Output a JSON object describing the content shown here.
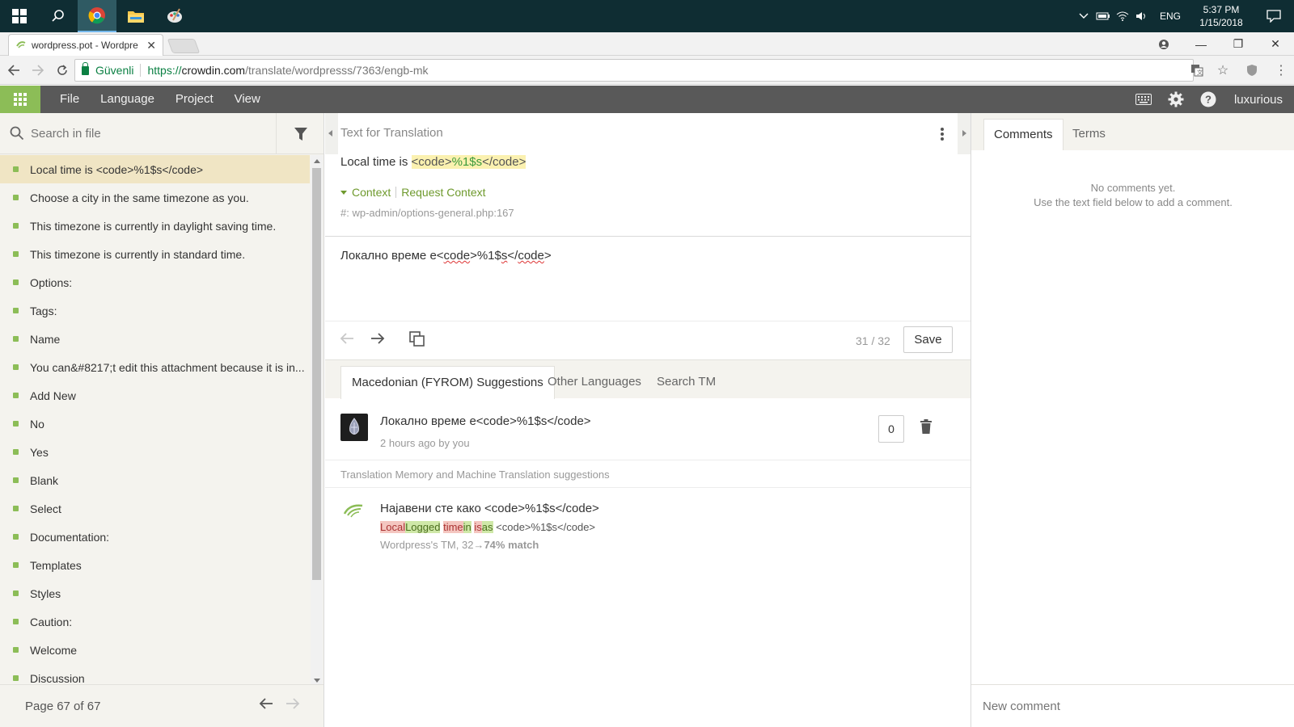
{
  "taskbar": {
    "language": "ENG",
    "time": "5:37 PM",
    "date": "1/15/2018"
  },
  "browser": {
    "tab_title": "wordpress.pot - Wordpre",
    "secure_label": "Güvenli",
    "url_scheme": "https://",
    "url_host": "crowdin.com",
    "url_path": "/translate/wordpresss/7363/engb-mk"
  },
  "header": {
    "menu": [
      "File",
      "Language",
      "Project",
      "View"
    ],
    "username": "luxurious",
    "accent_color": "#8cbd57"
  },
  "left": {
    "search_placeholder": "Search in file",
    "strings": [
      "Local time is <code>%1$s</code>",
      "Choose a city in the same timezone as you.",
      "This timezone is currently in daylight saving time.",
      "This timezone is currently in standard time.",
      "Options:",
      "Tags:",
      "Name",
      "You can&#8217;t edit this attachment because it is in...",
      "Add New",
      "No",
      "Yes",
      "Blank",
      "Select",
      "Documentation:",
      "Templates",
      "Styles",
      "Caution:",
      "Welcome",
      "Discussion"
    ],
    "page_label": "Page 67 of 67"
  },
  "editor": {
    "source_label": "Text for Translation",
    "source_prefix": "Local time is ",
    "source_tag_open": "<code>",
    "source_placeholder": "%1$s",
    "source_tag_close": "</code>",
    "context_label": "Context",
    "request_context_label": "Request Context",
    "context_path": "#: wp-admin/options-general.php:167",
    "translation_prefix": "Локално време е<",
    "translation_code1": "code",
    "translation_mid": ">%1$",
    "translation_s": "s",
    "translation_close": "</",
    "translation_code2": "code",
    "translation_end": ">",
    "counter": "31 / 32",
    "save_label": "Save"
  },
  "suggestions": {
    "tabs": [
      "Macedonian (FYROM) Suggestions",
      "Other Languages",
      "Search TM"
    ],
    "item": {
      "text": "Локално време е<code>%1$s</code>",
      "meta": "2 hours ago by you",
      "votes": "0"
    },
    "tm_label": "Translation Memory and Machine Translation suggestions",
    "tm_item": {
      "text": "Најавени сте како <code>%1$s</code>",
      "diff": [
        {
          "text": "Local",
          "type": "del"
        },
        {
          "text": "Logged",
          "type": "ins"
        },
        {
          "text": " ",
          "type": "eq"
        },
        {
          "text": "time",
          "type": "del"
        },
        {
          "text": "in",
          "type": "ins"
        },
        {
          "text": " ",
          "type": "eq"
        },
        {
          "text": "is",
          "type": "del"
        },
        {
          "text": "as",
          "type": "ins"
        },
        {
          "text": " <code>%1$s</code>",
          "type": "eq"
        }
      ],
      "meta_prefix": "Wordpress's TM, 32→",
      "meta_match": "74% match"
    }
  },
  "comments": {
    "tabs": [
      "Comments",
      "Terms"
    ],
    "empty_line1": "No comments yet.",
    "empty_line2": "Use the text field below to add a comment.",
    "placeholder": "New comment"
  }
}
